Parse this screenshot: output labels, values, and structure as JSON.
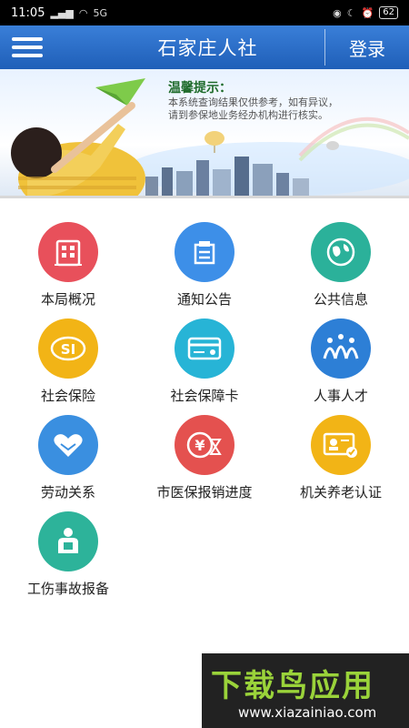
{
  "status_bar": {
    "time": "11:05",
    "signal": "5G",
    "battery": "62"
  },
  "header": {
    "title": "石家庄人社",
    "login_label": "登录"
  },
  "banner": {
    "tip_title": "温馨提示：",
    "tip_line1": "本系统查询结果仅供参考，如有异议，",
    "tip_line2": "请到参保地业务经办机构进行核实。"
  },
  "menu": {
    "items": [
      {
        "label": "本局概况",
        "icon": "building-icon",
        "color": "#e8505b"
      },
      {
        "label": "通知公告",
        "icon": "notice-icon",
        "color": "#3d8fe8"
      },
      {
        "label": "公共信息",
        "icon": "globe-icon",
        "color": "#2bb19a"
      },
      {
        "label": "社会保险",
        "icon": "si-icon",
        "color": "#f2b416"
      },
      {
        "label": "社会保障卡",
        "icon": "card-icon",
        "color": "#27b4d6"
      },
      {
        "label": "人事人才",
        "icon": "people-icon",
        "color": "#2d7fd6"
      },
      {
        "label": "劳动关系",
        "icon": "handshake-icon",
        "color": "#3a8fe0"
      },
      {
        "label": "市医保报销进度",
        "icon": "yen-hourglass-icon",
        "color": "#e4514f"
      },
      {
        "label": "机关养老认证",
        "icon": "id-check-icon",
        "color": "#f2b416"
      },
      {
        "label": "工伤事故报备",
        "icon": "worker-icon",
        "color": "#2db39a"
      }
    ]
  },
  "watermark": {
    "title": "下载鸟应用",
    "url": "www.xiazainiao.com"
  }
}
